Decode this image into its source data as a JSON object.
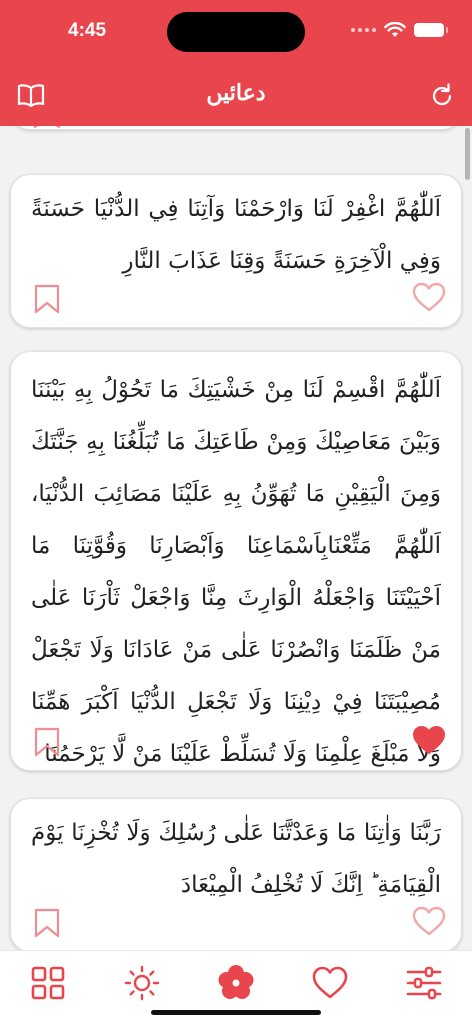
{
  "status_bar": {
    "time": "4:45"
  },
  "header": {
    "title": "دعائیں",
    "color": "#e8454c",
    "left_icon": "book-open-icon",
    "right_icon": "refresh-icon"
  },
  "duas": [
    {
      "text": "اَللّٰهُمَّ اغْفِرْ لَنَا وَارْحَمْنَا وَآتِنَا فِي الدُّنْيَا حَسَنَةً وَفِي الْآخِرَةِ حَسَنَةً وَقِنَا عَذَابَ النَّارِ",
      "favorite": false
    },
    {
      "text": "اَللّٰهُمَّ اقْسِمْ لَنَا مِنْ خَشْيَتِكَ مَا تَحُوْلُ بِهِ بَيْنَنَا وَبَيْنَ مَعَاصِيْكَ وَمِنْ طَاعَتِكَ مَا تُبَلِّغُنَا بِهِ جَنَّتَكَ وَمِنَ الْيَقِيْنِ مَا تُهَوِّنُ بِهِ عَلَيْنَا مَصَائِبَ الدُّنْيَا، اَللّٰهُمَّ مَتِّعْنَابِاَسْمَاعِنَا وَاَبْصَارِنَا وَقُوَّتِنَا مَا اَحْيَيْتَنَا وَاجْعَلْهُ الْوَارِثَ مِنَّا وَاجْعَلْ ثَاْرَنَا عَلٰى مَنْ ظَلَمَنَا وَانْصُرْنَا عَلٰى مَنْ عَادَانَا وَلَا تَجْعَلْ مُصِيْبَتَنَا فِيْ دِيْنِنَا وَلَا تَجْعَلِ الدُّنْيَا اَكْبَرَ هَمِّنَا وَلَا مَبْلَغَ عِلْمِنَا وَلَا تُسَلِّطْ عَلَيْنَا مَنْ لَّا يَرْحَمُنَا",
      "favorite": true
    },
    {
      "text": "رَبَّنَا وَاٰتِنَا مَا وَعَدْتَّنَا عَلٰى رُسُلِكَ وَلَا تُخْزِنَا يَوْمَ الْقِيَامَةِ ؕ اِنَّكَ لَا تُخْلِفُ الْمِيْعَادَ",
      "favorite": false
    }
  ],
  "tabs": [
    {
      "icon": "grid-icon"
    },
    {
      "icon": "sun-icon"
    },
    {
      "icon": "flower-icon"
    },
    {
      "icon": "heart-icon"
    },
    {
      "icon": "sliders-icon"
    }
  ],
  "colors": {
    "accent": "#e8454c",
    "heart_outline": "#f0a8ab",
    "bookmark_outline": "#ee8d92"
  }
}
